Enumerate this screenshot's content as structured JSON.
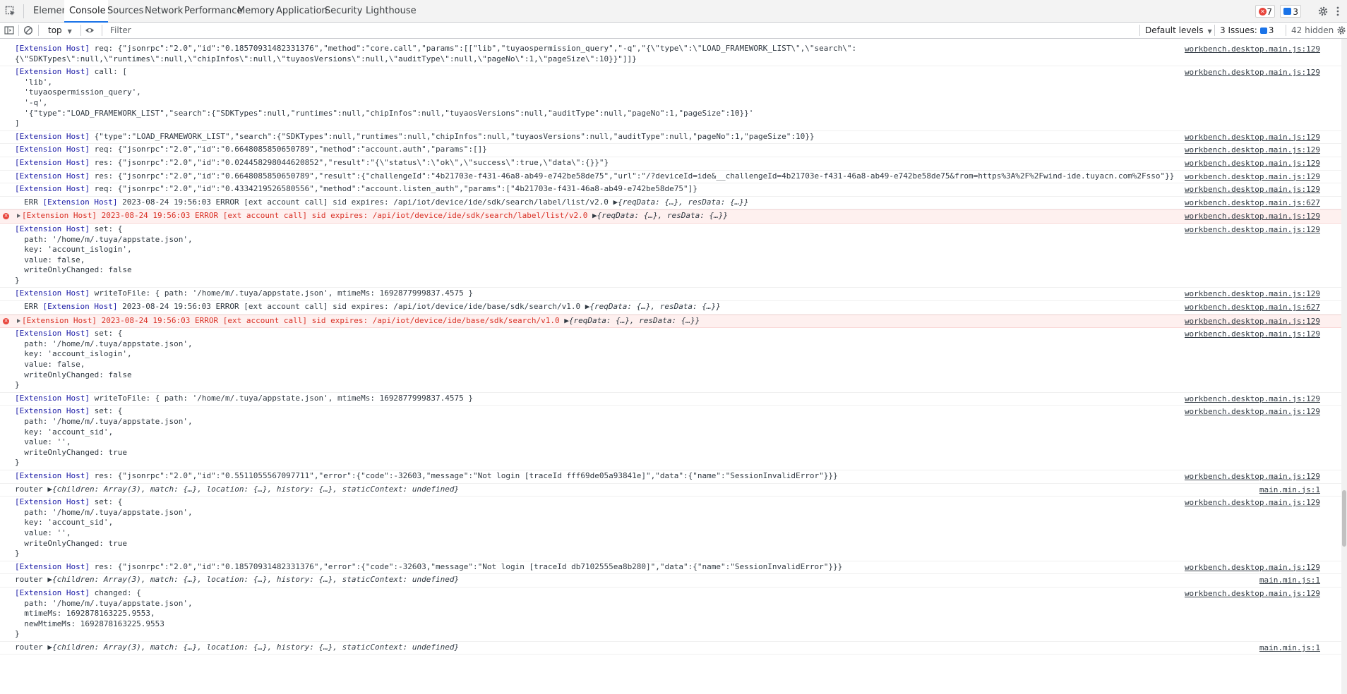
{
  "tabs": [
    "Elements",
    "Console",
    "Sources",
    "Network",
    "Performance",
    "Memory",
    "Application",
    "Security",
    "Lighthouse"
  ],
  "active_tab": "Console",
  "error_count": "7",
  "message_count": "3",
  "toolbar": {
    "context": "top",
    "filter_placeholder": "Filter",
    "levels": "Default levels",
    "issues_label": "3 Issues:",
    "issues_count": "3",
    "hidden": "42 hidden"
  },
  "messages": [
    {
      "type": "log",
      "text": "[Extension Host] req: {\"jsonrpc\":\"2.0\",\"id\":\"0.18570931482331376\",\"method\":\"core.call\",\"params\":[[\"lib\",\"tuyaospermission_query\",\"-q\",\"{\\\"type\\\":\\\"LOAD_FRAMEWORK_LIST\\\",\\\"search\\\":\n{\\\"SDKTypes\\\":null,\\\"runtimes\\\":null,\\\"chipInfos\\\":null,\\\"tuyaosVersions\\\":null,\\\"auditType\\\":null,\\\"pageNo\\\":1,\\\"pageSize\\\":10}}\"]]}",
      "source": "workbench.desktop.main.js:129"
    },
    {
      "type": "log",
      "text": "[Extension Host] call: [\n  'lib',\n  'tuyaospermission_query',\n  '-q',\n  '{\"type\":\"LOAD_FRAMEWORK_LIST\",\"search\":{\"SDKTypes\":null,\"runtimes\":null,\"chipInfos\":null,\"tuyaosVersions\":null,\"auditType\":null,\"pageNo\":1,\"pageSize\":10}}'\n]",
      "source": "workbench.desktop.main.js:129"
    },
    {
      "type": "log",
      "text": "[Extension Host] {\"type\":\"LOAD_FRAMEWORK_LIST\",\"search\":{\"SDKTypes\":null,\"runtimes\":null,\"chipInfos\":null,\"tuyaosVersions\":null,\"auditType\":null,\"pageNo\":1,\"pageSize\":10}}",
      "source": "workbench.desktop.main.js:129"
    },
    {
      "type": "log",
      "text": "[Extension Host] req: {\"jsonrpc\":\"2.0\",\"id\":\"0.6648085850650789\",\"method\":\"account.auth\",\"params\":[]}",
      "source": "workbench.desktop.main.js:129"
    },
    {
      "type": "log",
      "text": "[Extension Host] res: {\"jsonrpc\":\"2.0\",\"id\":\"0.024458298044620852\",\"result\":\"{\\\"status\\\":\\\"ok\\\",\\\"success\\\":true,\\\"data\\\":{}}\"}",
      "source": "workbench.desktop.main.js:129"
    },
    {
      "type": "log",
      "text": "[Extension Host] res: {\"jsonrpc\":\"2.0\",\"id\":\"0.6648085850650789\",\"result\":{\"challengeId\":\"4b21703e-f431-46a8-ab49-e742be58de75\",\"url\":\"/?deviceId=ide&__challengeId=4b21703e-f431-46a8-ab49-e742be58de75&from=https%3A%2F%2Fwind-ide.tuyacn.com%2Fsso\"}}",
      "source": "workbench.desktop.main.js:129"
    },
    {
      "type": "log",
      "text": "[Extension Host] req: {\"jsonrpc\":\"2.0\",\"id\":\"0.4334219526580556\",\"method\":\"account.listen_auth\",\"params\":[\"4b21703e-f431-46a8-ab49-e742be58de75\"]}",
      "source": "workbench.desktop.main.js:129"
    },
    {
      "type": "errtxt",
      "text": "ERR [Extension Host] 2023-08-24 19:56:03 ERROR [ext account call] sid expires: /api/iot/device/ide/sdk/search/label/list/v2.0 ▶{reqData: {…}, resData: {…}}",
      "source": "workbench.desktop.main.js:627"
    },
    {
      "type": "err",
      "text": "[Extension Host] 2023-08-24 19:56:03 ERROR [ext account call] sid expires: /api/iot/device/ide/sdk/search/label/list/v2.0 ▶{reqData: {…}, resData: {…}}",
      "source": "workbench.desktop.main.js:129"
    },
    {
      "type": "log",
      "text": "[Extension Host] set: {\n  path: '/home/m/.tuya/appstate.json',\n  key: 'account_islogin',\n  value: false,\n  writeOnlyChanged: false\n}",
      "source": "workbench.desktop.main.js:129"
    },
    {
      "type": "log",
      "text": "[Extension Host] writeToFile: { path: '/home/m/.tuya/appstate.json', mtimeMs: 1692877999837.4575 }",
      "source": "workbench.desktop.main.js:129"
    },
    {
      "type": "errtxt",
      "text": "ERR [Extension Host] 2023-08-24 19:56:03 ERROR [ext account call] sid expires: /api/iot/device/ide/base/sdk/search/v1.0 ▶{reqData: {…}, resData: {…}}",
      "source": "workbench.desktop.main.js:627"
    },
    {
      "type": "err",
      "text": "[Extension Host] 2023-08-24 19:56:03 ERROR [ext account call] sid expires: /api/iot/device/ide/base/sdk/search/v1.0 ▶{reqData: {…}, resData: {…}}",
      "source": "workbench.desktop.main.js:129"
    },
    {
      "type": "log",
      "text": "[Extension Host] set: {\n  path: '/home/m/.tuya/appstate.json',\n  key: 'account_islogin',\n  value: false,\n  writeOnlyChanged: false\n}",
      "source": "workbench.desktop.main.js:129"
    },
    {
      "type": "log",
      "text": "[Extension Host] writeToFile: { path: '/home/m/.tuya/appstate.json', mtimeMs: 1692877999837.4575 }",
      "source": "workbench.desktop.main.js:129"
    },
    {
      "type": "log",
      "text": "[Extension Host] set: {\n  path: '/home/m/.tuya/appstate.json',\n  key: 'account_sid',\n  value: '',\n  writeOnlyChanged: true\n}",
      "source": "workbench.desktop.main.js:129"
    },
    {
      "type": "log",
      "text": "[Extension Host] res: {\"jsonrpc\":\"2.0\",\"id\":\"0.5511055567097711\",\"error\":{\"code\":-32603,\"message\":\"Not login [traceId fff69de05a93841e]\",\"data\":{\"name\":\"SessionInvalidError\"}}}",
      "source": "workbench.desktop.main.js:129"
    },
    {
      "type": "router",
      "text": "router ▶{children: Array(3), match: {…}, location: {…}, history: {…}, staticContext: undefined}",
      "source": "main.min.js:1"
    },
    {
      "type": "log",
      "text": "[Extension Host] set: {\n  path: '/home/m/.tuya/appstate.json',\n  key: 'account_sid',\n  value: '',\n  writeOnlyChanged: true\n}",
      "source": "workbench.desktop.main.js:129"
    },
    {
      "type": "log",
      "text": "[Extension Host] res: {\"jsonrpc\":\"2.0\",\"id\":\"0.18570931482331376\",\"error\":{\"code\":-32603,\"message\":\"Not login [traceId db7102555ea8b280]\",\"data\":{\"name\":\"SessionInvalidError\"}}}",
      "source": "workbench.desktop.main.js:129"
    },
    {
      "type": "router",
      "text": "router ▶{children: Array(3), match: {…}, location: {…}, history: {…}, staticContext: undefined}",
      "source": "main.min.js:1"
    },
    {
      "type": "log",
      "text": "[Extension Host] changed: {\n  path: '/home/m/.tuya/appstate.json',\n  mtimeMs: 1692878163225.9553,\n  newMtimeMs: 1692878163225.9553\n}",
      "source": "workbench.desktop.main.js:129"
    },
    {
      "type": "router",
      "text": "router ▶{children: Array(3), match: {…}, location: {…}, history: {…}, staticContext: undefined}",
      "source": "main.min.js:1"
    }
  ],
  "colors": {
    "extension_host_blue": "#1a1aa6",
    "error_red": "#d93025",
    "error_bg": "#fef0ef",
    "accent": "#1a73e8"
  }
}
